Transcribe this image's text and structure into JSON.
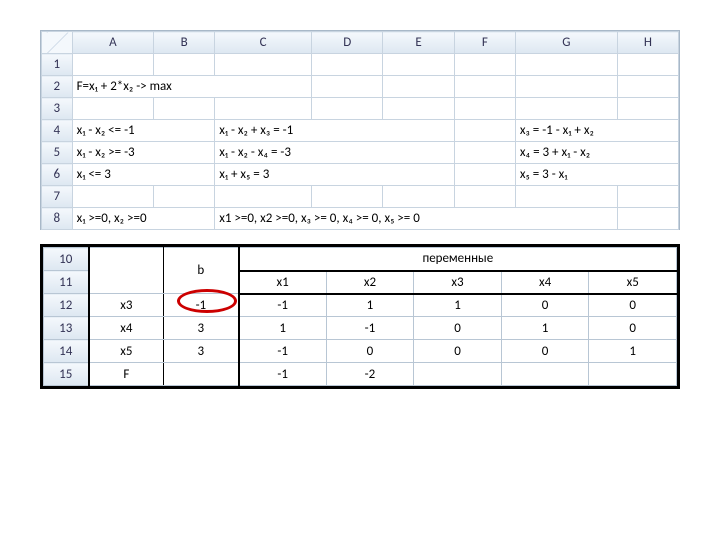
{
  "sheet1": {
    "columns": [
      "A",
      "B",
      "C",
      "D",
      "E",
      "F",
      "G",
      "H"
    ],
    "rows": [
      "1",
      "2",
      "3",
      "4",
      "5",
      "6",
      "7",
      "8"
    ],
    "cells": {
      "A2": "F=x₁ + 2*x₂ -> max",
      "A4": "x₁ - x₂ <= -1",
      "C4": "x₁ - x₂  + x₃ = -1",
      "G4": "x₃ = -1 - x₁ + x₂",
      "A5": "x₁ - x₂ >= -3",
      "C5": "x₁ - x₂ - x₄ = -3",
      "G5": "x₄ = 3 + x₁ - x₂",
      "A6": "x₁ <= 3",
      "C6": "x₁ + x₅ = 3",
      "G6": "x₅ = 3 - x₁",
      "A8": "x₁ >=0,  x₂ >=0",
      "C8": "x1 >=0, x2 >=0, x₃ >= 0, x₄ >= 0, x₅ >= 0"
    }
  },
  "sheet2": {
    "rows": [
      "10",
      "11",
      "12",
      "13",
      "14",
      "15"
    ],
    "b_label": "b",
    "vars_label": "переменные",
    "var_headers": [
      "x1",
      "x2",
      "x3",
      "x4",
      "x5"
    ],
    "data_rows": [
      {
        "basis": "x3",
        "b": "-1",
        "v": [
          "-1",
          "1",
          "1",
          "0",
          "0"
        ]
      },
      {
        "basis": "x4",
        "b": "3",
        "v": [
          "1",
          "-1",
          "0",
          "1",
          "0"
        ]
      },
      {
        "basis": "x5",
        "b": "3",
        "v": [
          "-1",
          "0",
          "0",
          "0",
          "1"
        ]
      }
    ],
    "f_row": {
      "basis": "F",
      "b": "",
      "v": [
        "-1",
        "-2",
        "",
        "",
        ""
      ]
    }
  },
  "highlight": {
    "cell": "b_row12",
    "color": "#c00"
  }
}
